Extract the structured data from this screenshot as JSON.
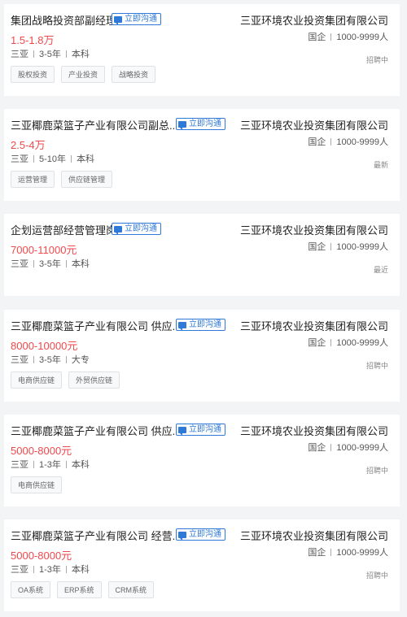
{
  "chat_label": "立即沟通",
  "jobs": [
    {
      "title": "集团战略投资部副经理",
      "salary": "1.5-1.8万",
      "city": "三亚",
      "experience": "3-5年",
      "education": "本科",
      "tags": [
        "股权投资",
        "产业投资",
        "战略投资"
      ],
      "company": "三亚环境农业投资集团有限公司",
      "company_type": "国企",
      "company_size": "1000-9999人",
      "status": "招聘中"
    },
    {
      "title": "三亚椰鹿菜篮子产业有限公司副总...",
      "salary": "2.5-4万",
      "city": "三亚",
      "experience": "5-10年",
      "education": "本科",
      "tags": [
        "运营管理",
        "供应链管理"
      ],
      "company": "三亚环境农业投资集团有限公司",
      "company_type": "国企",
      "company_size": "1000-9999人",
      "status": "最新"
    },
    {
      "title": "企划运营部经营管理岗",
      "salary": "7000-11000元",
      "city": "三亚",
      "experience": "3-5年",
      "education": "本科",
      "tags": [],
      "company": "三亚环境农业投资集团有限公司",
      "company_type": "国企",
      "company_size": "1000-9999人",
      "status": "最近"
    },
    {
      "title": "三亚椰鹿菜篮子产业有限公司 供应...",
      "salary": "8000-10000元",
      "city": "三亚",
      "experience": "3-5年",
      "education": "大专",
      "tags": [
        "电商供应链",
        "外贸供应链"
      ],
      "company": "三亚环境农业投资集团有限公司",
      "company_type": "国企",
      "company_size": "1000-9999人",
      "status": "招聘中"
    },
    {
      "title": "三亚椰鹿菜篮子产业有限公司 供应...",
      "salary": "5000-8000元",
      "city": "三亚",
      "experience": "1-3年",
      "education": "本科",
      "tags": [
        "电商供应链"
      ],
      "company": "三亚环境农业投资集团有限公司",
      "company_type": "国企",
      "company_size": "1000-9999人",
      "status": "招聘中"
    },
    {
      "title": "三亚椰鹿菜篮子产业有限公司 经营...",
      "salary": "5000-8000元",
      "city": "三亚",
      "experience": "1-3年",
      "education": "本科",
      "tags": [
        "OA系统",
        "ERP系统",
        "CRM系统"
      ],
      "company": "三亚环境农业投资集团有限公司",
      "company_type": "国企",
      "company_size": "1000-9999人",
      "status": "招聘中"
    }
  ]
}
